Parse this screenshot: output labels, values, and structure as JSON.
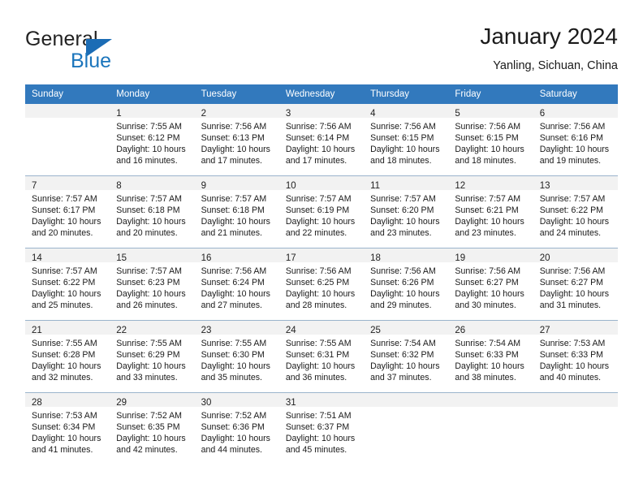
{
  "brand": {
    "name_part1": "General",
    "name_part2": "Blue",
    "triangle_icon": "triangle-icon",
    "color_primary": "#1b75bc",
    "color_dark": "#222222"
  },
  "header": {
    "title": "January 2024",
    "subtitle": "Yanling, Sichuan, China"
  },
  "calendar": {
    "header_bg": "#3279bd",
    "daynum_bg": "#f2f2f2",
    "row_border": "#9ab4cc",
    "weekday_headers": [
      "Sunday",
      "Monday",
      "Tuesday",
      "Wednesday",
      "Thursday",
      "Friday",
      "Saturday"
    ],
    "weeks": [
      [
        {
          "day": "",
          "lines": []
        },
        {
          "day": "1",
          "lines": [
            "Sunrise: 7:55 AM",
            "Sunset: 6:12 PM",
            "Daylight: 10 hours",
            "and 16 minutes."
          ]
        },
        {
          "day": "2",
          "lines": [
            "Sunrise: 7:56 AM",
            "Sunset: 6:13 PM",
            "Daylight: 10 hours",
            "and 17 minutes."
          ]
        },
        {
          "day": "3",
          "lines": [
            "Sunrise: 7:56 AM",
            "Sunset: 6:14 PM",
            "Daylight: 10 hours",
            "and 17 minutes."
          ]
        },
        {
          "day": "4",
          "lines": [
            "Sunrise: 7:56 AM",
            "Sunset: 6:15 PM",
            "Daylight: 10 hours",
            "and 18 minutes."
          ]
        },
        {
          "day": "5",
          "lines": [
            "Sunrise: 7:56 AM",
            "Sunset: 6:15 PM",
            "Daylight: 10 hours",
            "and 18 minutes."
          ]
        },
        {
          "day": "6",
          "lines": [
            "Sunrise: 7:56 AM",
            "Sunset: 6:16 PM",
            "Daylight: 10 hours",
            "and 19 minutes."
          ]
        }
      ],
      [
        {
          "day": "7",
          "lines": [
            "Sunrise: 7:57 AM",
            "Sunset: 6:17 PM",
            "Daylight: 10 hours",
            "and 20 minutes."
          ]
        },
        {
          "day": "8",
          "lines": [
            "Sunrise: 7:57 AM",
            "Sunset: 6:18 PM",
            "Daylight: 10 hours",
            "and 20 minutes."
          ]
        },
        {
          "day": "9",
          "lines": [
            "Sunrise: 7:57 AM",
            "Sunset: 6:18 PM",
            "Daylight: 10 hours",
            "and 21 minutes."
          ]
        },
        {
          "day": "10",
          "lines": [
            "Sunrise: 7:57 AM",
            "Sunset: 6:19 PM",
            "Daylight: 10 hours",
            "and 22 minutes."
          ]
        },
        {
          "day": "11",
          "lines": [
            "Sunrise: 7:57 AM",
            "Sunset: 6:20 PM",
            "Daylight: 10 hours",
            "and 23 minutes."
          ]
        },
        {
          "day": "12",
          "lines": [
            "Sunrise: 7:57 AM",
            "Sunset: 6:21 PM",
            "Daylight: 10 hours",
            "and 23 minutes."
          ]
        },
        {
          "day": "13",
          "lines": [
            "Sunrise: 7:57 AM",
            "Sunset: 6:22 PM",
            "Daylight: 10 hours",
            "and 24 minutes."
          ]
        }
      ],
      [
        {
          "day": "14",
          "lines": [
            "Sunrise: 7:57 AM",
            "Sunset: 6:22 PM",
            "Daylight: 10 hours",
            "and 25 minutes."
          ]
        },
        {
          "day": "15",
          "lines": [
            "Sunrise: 7:57 AM",
            "Sunset: 6:23 PM",
            "Daylight: 10 hours",
            "and 26 minutes."
          ]
        },
        {
          "day": "16",
          "lines": [
            "Sunrise: 7:56 AM",
            "Sunset: 6:24 PM",
            "Daylight: 10 hours",
            "and 27 minutes."
          ]
        },
        {
          "day": "17",
          "lines": [
            "Sunrise: 7:56 AM",
            "Sunset: 6:25 PM",
            "Daylight: 10 hours",
            "and 28 minutes."
          ]
        },
        {
          "day": "18",
          "lines": [
            "Sunrise: 7:56 AM",
            "Sunset: 6:26 PM",
            "Daylight: 10 hours",
            "and 29 minutes."
          ]
        },
        {
          "day": "19",
          "lines": [
            "Sunrise: 7:56 AM",
            "Sunset: 6:27 PM",
            "Daylight: 10 hours",
            "and 30 minutes."
          ]
        },
        {
          "day": "20",
          "lines": [
            "Sunrise: 7:56 AM",
            "Sunset: 6:27 PM",
            "Daylight: 10 hours",
            "and 31 minutes."
          ]
        }
      ],
      [
        {
          "day": "21",
          "lines": [
            "Sunrise: 7:55 AM",
            "Sunset: 6:28 PM",
            "Daylight: 10 hours",
            "and 32 minutes."
          ]
        },
        {
          "day": "22",
          "lines": [
            "Sunrise: 7:55 AM",
            "Sunset: 6:29 PM",
            "Daylight: 10 hours",
            "and 33 minutes."
          ]
        },
        {
          "day": "23",
          "lines": [
            "Sunrise: 7:55 AM",
            "Sunset: 6:30 PM",
            "Daylight: 10 hours",
            "and 35 minutes."
          ]
        },
        {
          "day": "24",
          "lines": [
            "Sunrise: 7:55 AM",
            "Sunset: 6:31 PM",
            "Daylight: 10 hours",
            "and 36 minutes."
          ]
        },
        {
          "day": "25",
          "lines": [
            "Sunrise: 7:54 AM",
            "Sunset: 6:32 PM",
            "Daylight: 10 hours",
            "and 37 minutes."
          ]
        },
        {
          "day": "26",
          "lines": [
            "Sunrise: 7:54 AM",
            "Sunset: 6:33 PM",
            "Daylight: 10 hours",
            "and 38 minutes."
          ]
        },
        {
          "day": "27",
          "lines": [
            "Sunrise: 7:53 AM",
            "Sunset: 6:33 PM",
            "Daylight: 10 hours",
            "and 40 minutes."
          ]
        }
      ],
      [
        {
          "day": "28",
          "lines": [
            "Sunrise: 7:53 AM",
            "Sunset: 6:34 PM",
            "Daylight: 10 hours",
            "and 41 minutes."
          ]
        },
        {
          "day": "29",
          "lines": [
            "Sunrise: 7:52 AM",
            "Sunset: 6:35 PM",
            "Daylight: 10 hours",
            "and 42 minutes."
          ]
        },
        {
          "day": "30",
          "lines": [
            "Sunrise: 7:52 AM",
            "Sunset: 6:36 PM",
            "Daylight: 10 hours",
            "and 44 minutes."
          ]
        },
        {
          "day": "31",
          "lines": [
            "Sunrise: 7:51 AM",
            "Sunset: 6:37 PM",
            "Daylight: 10 hours",
            "and 45 minutes."
          ]
        },
        {
          "day": "",
          "lines": []
        },
        {
          "day": "",
          "lines": []
        },
        {
          "day": "",
          "lines": []
        }
      ]
    ]
  }
}
